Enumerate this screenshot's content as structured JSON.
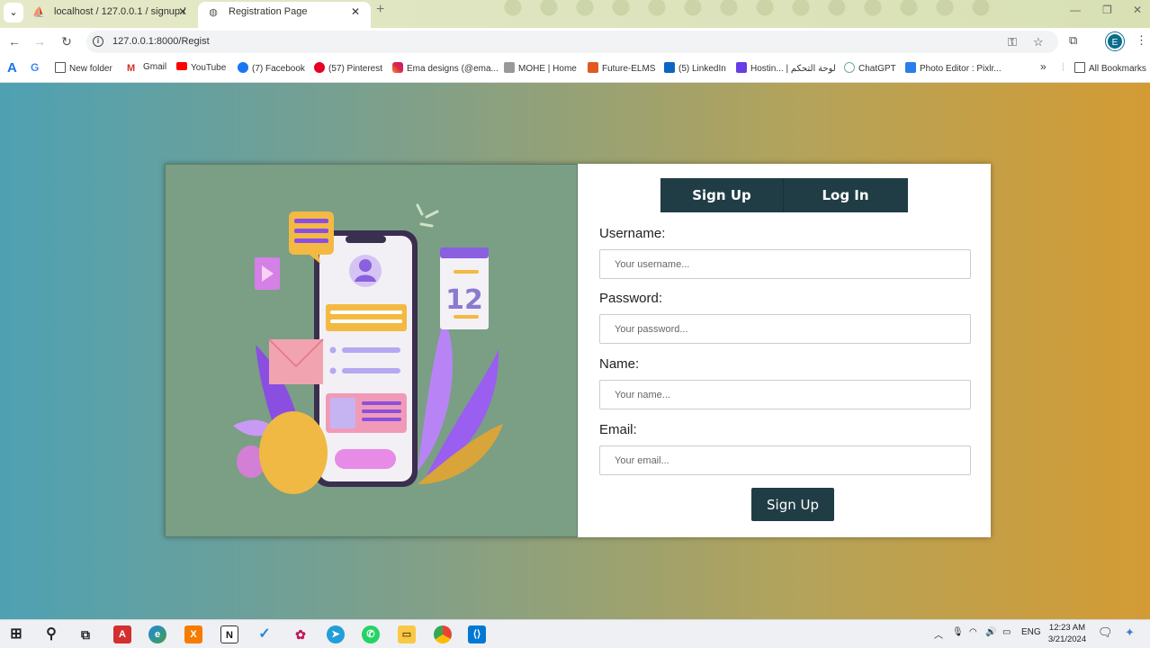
{
  "browser": {
    "tabs": [
      {
        "title": "localhost / 127.0.0.1 / signup /",
        "active": false
      },
      {
        "title": "Registration Page",
        "active": true
      }
    ],
    "url": "127.0.0.1:8000/Regist",
    "profile_initial": "E",
    "bookmarks": [
      {
        "label": "",
        "icon": "font-icon",
        "color": "#1a73e8"
      },
      {
        "label": "",
        "icon": "google-icon",
        "color": "#4285f4"
      },
      {
        "label": "New folder",
        "icon": "folder-icon",
        "color": "#555555"
      },
      {
        "label": "Gmail",
        "icon": "gmail-icon",
        "color": "#d93025"
      },
      {
        "label": "YouTube",
        "icon": "youtube-icon",
        "color": "#ff0000"
      },
      {
        "label": "(7) Facebook",
        "icon": "facebook-icon",
        "color": "#1877f2"
      },
      {
        "label": "(57) Pinterest",
        "icon": "pinterest-icon",
        "color": "#e60023"
      },
      {
        "label": "Ema designs (@ema...",
        "icon": "instagram-icon",
        "color": "#c13584"
      },
      {
        "label": "MOHE | Home",
        "icon": "mohe-icon",
        "color": "#777777"
      },
      {
        "label": "Future-ELMS",
        "icon": "elms-icon",
        "color": "#e25822"
      },
      {
        "label": "(5) LinkedIn",
        "icon": "linkedin-icon",
        "color": "#0a66c2"
      },
      {
        "label": "Hostin... | لوحة التحكم",
        "icon": "hostinger-icon",
        "color": "#673de6"
      },
      {
        "label": "ChatGPT",
        "icon": "chatgpt-icon",
        "color": "#74aa9c"
      },
      {
        "label": "Photo Editor : Pixlr...",
        "icon": "pixlr-icon",
        "color": "#2b7de9"
      }
    ],
    "all_bookmarks": "All Bookmarks"
  },
  "form": {
    "tab_signup": "Sign Up",
    "tab_login": "Log In",
    "fields": [
      {
        "label": "Username:",
        "placeholder": "Your username..."
      },
      {
        "label": "Password:",
        "placeholder": "Your password..."
      },
      {
        "label": "Name:",
        "placeholder": "Your name..."
      },
      {
        "label": "Email:",
        "placeholder": "Your email..."
      }
    ],
    "submit": "Sign Up"
  },
  "illustration": {
    "calendar_number": "12"
  },
  "taskbar": {
    "language": "ENG",
    "time": "12:23 AM",
    "date": "3/21/2024"
  },
  "colors": {
    "accent": "#203d45",
    "gradient_left": "#4ea1b3",
    "gradient_right": "#d49b34"
  }
}
